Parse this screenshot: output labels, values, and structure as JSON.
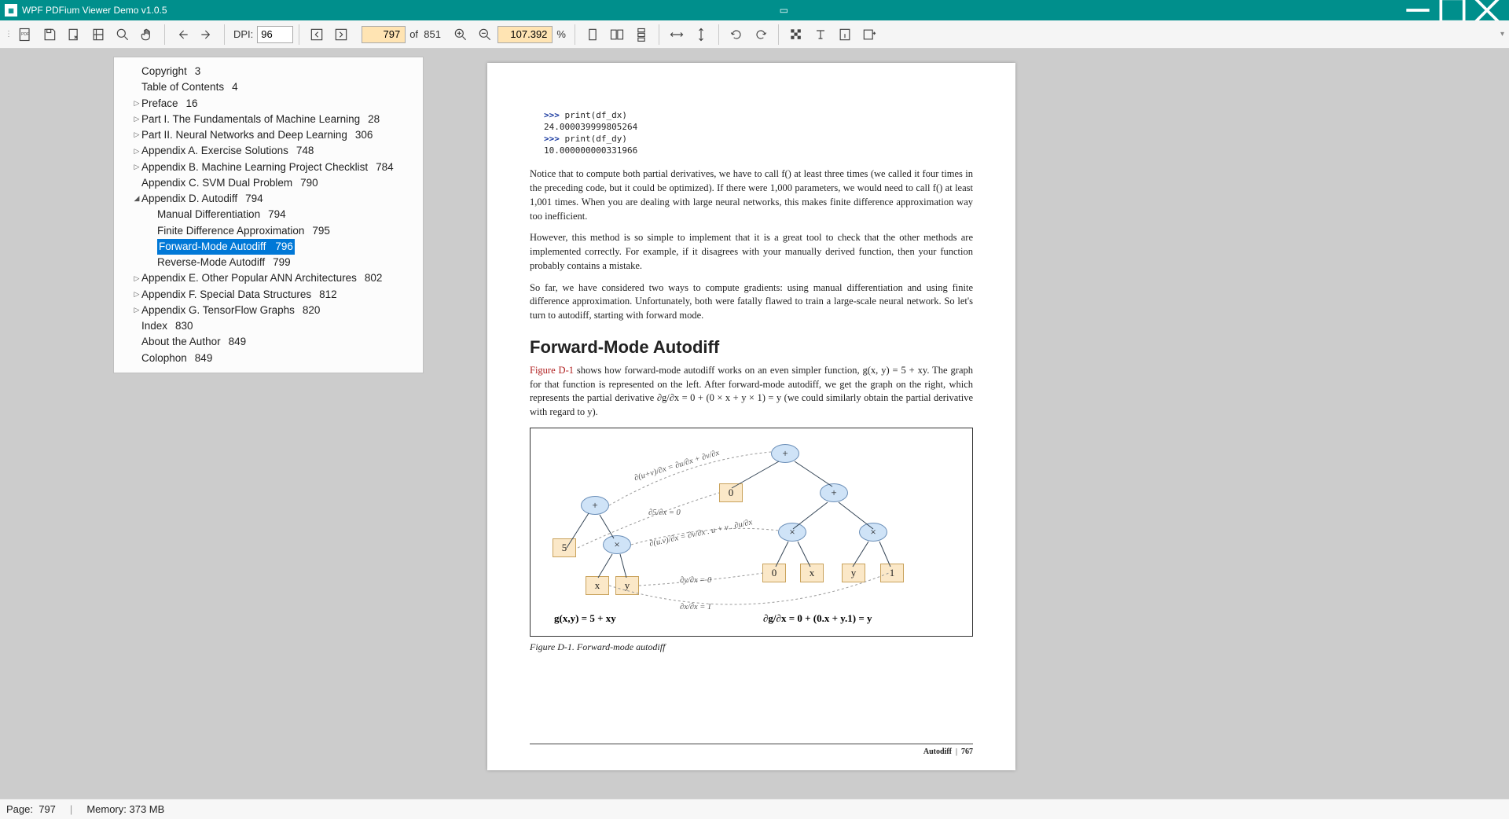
{
  "title": "WPF PDFium Viewer Demo v1.0.5",
  "toolbar": {
    "dpi_label": "DPI:",
    "dpi_value": "96",
    "page_current": "797",
    "page_of_label": "of",
    "page_total": "851",
    "zoom_value": "107.392",
    "zoom_pct": "%"
  },
  "outline": [
    {
      "depth": 1,
      "expand": "",
      "label": "Copyright",
      "page": "3"
    },
    {
      "depth": 1,
      "expand": "",
      "label": "Table of Contents",
      "page": "4"
    },
    {
      "depth": 1,
      "expand": "▷",
      "label": "Preface",
      "page": "16"
    },
    {
      "depth": 1,
      "expand": "▷",
      "label": "Part I. The Fundamentals of Machine Learning",
      "page": "28"
    },
    {
      "depth": 1,
      "expand": "▷",
      "label": "Part II. Neural Networks and Deep Learning",
      "page": "306"
    },
    {
      "depth": 1,
      "expand": "▷",
      "label": "Appendix A. Exercise Solutions",
      "page": "748"
    },
    {
      "depth": 1,
      "expand": "▷",
      "label": "Appendix B. Machine Learning Project Checklist",
      "page": "784"
    },
    {
      "depth": 1,
      "expand": "",
      "label": "Appendix C. SVM Dual Problem",
      "page": "790"
    },
    {
      "depth": 1,
      "expand": "◢",
      "label": "Appendix D. Autodiff",
      "page": "794"
    },
    {
      "depth": 2,
      "expand": "",
      "label": "Manual Differentiation",
      "page": "794"
    },
    {
      "depth": 2,
      "expand": "",
      "label": "Finite Difference Approximation",
      "page": "795"
    },
    {
      "depth": 2,
      "expand": "",
      "label": "Forward-Mode Autodiff",
      "page": "796",
      "selected": true
    },
    {
      "depth": 2,
      "expand": "",
      "label": "Reverse-Mode Autodiff",
      "page": "799"
    },
    {
      "depth": 1,
      "expand": "▷",
      "label": "Appendix E. Other Popular ANN Architectures",
      "page": "802"
    },
    {
      "depth": 1,
      "expand": "▷",
      "label": "Appendix F. Special Data Structures",
      "page": "812"
    },
    {
      "depth": 1,
      "expand": "▷",
      "label": "Appendix G. TensorFlow Graphs",
      "page": "820"
    },
    {
      "depth": 1,
      "expand": "",
      "label": "Index",
      "page": "830"
    },
    {
      "depth": 1,
      "expand": "",
      "label": "About the Author",
      "page": "849"
    },
    {
      "depth": 1,
      "expand": "",
      "label": "Colophon",
      "page": "849"
    }
  ],
  "page": {
    "code": [
      {
        "prompt": ">>> ",
        "rest": "print(df_dx)"
      },
      {
        "prompt": "",
        "rest": "24.000039999805264"
      },
      {
        "prompt": ">>> ",
        "rest": "print(df_dy)"
      },
      {
        "prompt": "",
        "rest": "10.000000000331966"
      }
    ],
    "para1": "Notice that to compute both partial derivatives, we have to call f() at least three times (we called it four times in the preceding code, but it could be optimized). If there were 1,000 parameters, we would need to call f() at least 1,001 times. When you are dealing with large neural networks, this makes finite difference approximation way too inefficient.",
    "para2": "However, this method is so simple to implement that it is a great tool to check that the other methods are implemented correctly. For example, if it disagrees with your manually derived function, then your function probably contains a mistake.",
    "para3": "So far, we have considered two ways to compute gradients: using manual differentiation and using finite difference approximation. Unfortunately, both were fatally flawed to train a large-scale neural network. So let's turn to autodiff, starting with forward mode.",
    "h2": "Forward-Mode Autodiff",
    "figref": "Figure D-1",
    "para4": " shows how forward-mode autodiff works on an even simpler function, g(x, y) = 5 + xy. The graph for that function is represented on the left. After forward-mode autodiff, we get the graph on the right, which represents the partial derivative ∂g/∂x = 0 + (0 × x + y × 1) = y (we could similarly obtain the partial derivative with regard to y).",
    "fig_caption": "Figure D-1. Forward-mode autodiff",
    "footer_section": "Autodiff",
    "footer_page": "767",
    "fig": {
      "left_formula": "g(x,y) = 5 + xy",
      "right_formula": "∂g/∂x = 0 + (0.x + y.1) = y",
      "ann_uv": "∂(u+v)/∂x = ∂u/∂x + ∂v/∂x",
      "ann_const": "∂5/∂x = 0",
      "ann_prod": "∂(u.v)/∂x = ∂v/∂x . u + v . ∂u/∂x",
      "ann_dy": "∂y/∂x = 0",
      "ann_dx": "∂x/∂x = 1"
    }
  },
  "status": {
    "page_label": "Page:",
    "page_value": "797",
    "mem_label": "Memory:",
    "mem_value": "373 MB"
  }
}
